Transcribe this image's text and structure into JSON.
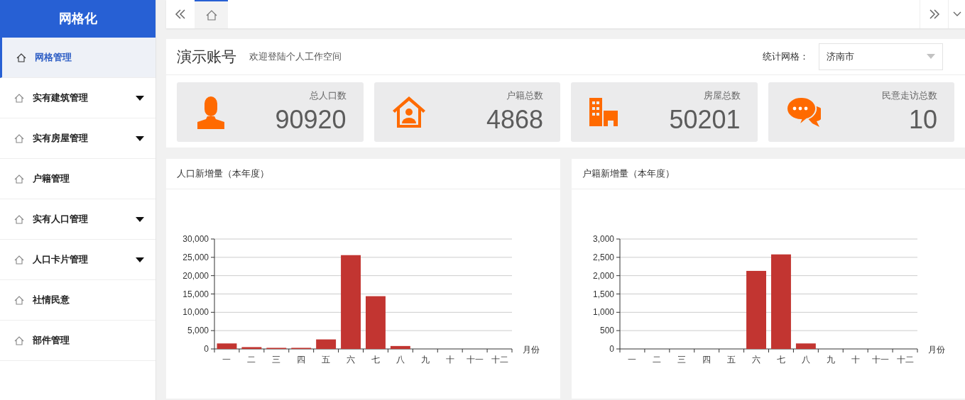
{
  "sidebar": {
    "title": "网格化",
    "items": [
      {
        "label": "网格管理",
        "selected": true,
        "has_submenu": false
      },
      {
        "label": "实有建筑管理",
        "selected": false,
        "has_submenu": true
      },
      {
        "label": "实有房屋管理",
        "selected": false,
        "has_submenu": true
      },
      {
        "label": "户籍管理",
        "selected": false,
        "has_submenu": false
      },
      {
        "label": "实有人口管理",
        "selected": false,
        "has_submenu": true
      },
      {
        "label": "人口卡片管理",
        "selected": false,
        "has_submenu": true
      },
      {
        "label": "社情民意",
        "selected": false,
        "has_submenu": false
      },
      {
        "label": "部件管理",
        "selected": false,
        "has_submenu": false
      }
    ]
  },
  "header": {
    "account": "演示账号",
    "welcome": "欢迎登陆个人工作空间",
    "grid_label": "统计网格：",
    "grid_select": {
      "value": "济南市"
    }
  },
  "stats": [
    {
      "kind": "person",
      "label": "总人口数",
      "value": "90920"
    },
    {
      "kind": "house",
      "label": "户籍总数",
      "value": "4868"
    },
    {
      "kind": "building",
      "label": "房屋总数",
      "value": "50201"
    },
    {
      "kind": "chat",
      "label": "民意走访总数",
      "value": "10"
    }
  ],
  "charts": [
    {
      "title": "人口新增量（本年度）",
      "chart_data": {
        "type": "bar",
        "xlabel": "月份",
        "categories": [
          "一",
          "二",
          "三",
          "四",
          "五",
          "六",
          "七",
          "八",
          "九",
          "十",
          "十一",
          "十二"
        ],
        "grid": true,
        "series": [
          {
            "color": "#c23531",
            "values": [
              1500,
              500,
              300,
              300,
              2600,
              25600,
              14400,
              800,
              0,
              0,
              0,
              0
            ]
          }
        ],
        "ylim": [
          0,
          30000
        ],
        "yticks": [
          {
            "value": 0,
            "label": "0"
          },
          {
            "value": 5000,
            "label": "5,000"
          },
          {
            "value": 10000,
            "label": "10,000"
          },
          {
            "value": 15000,
            "label": "15,000"
          },
          {
            "value": 20000,
            "label": "20,000"
          },
          {
            "value": 25000,
            "label": "25,000"
          },
          {
            "value": 30000,
            "label": "30,000"
          }
        ]
      }
    },
    {
      "title": "户籍新增量（本年度）",
      "chart_data": {
        "type": "bar",
        "xlabel": "月份",
        "categories": [
          "一",
          "二",
          "三",
          "四",
          "五",
          "六",
          "七",
          "八",
          "九",
          "十",
          "十一",
          "十二"
        ],
        "grid": true,
        "series": [
          {
            "color": "#c23531",
            "values": [
              0,
              0,
              0,
              0,
              0,
              2130,
              2580,
              150,
              0,
              0,
              0,
              0
            ]
          }
        ],
        "ylim": [
          0,
          3000
        ],
        "yticks": [
          {
            "value": 0,
            "label": "0"
          },
          {
            "value": 500,
            "label": "500"
          },
          {
            "value": 1000,
            "label": "1,000"
          },
          {
            "value": 1500,
            "label": "1,500"
          },
          {
            "value": 2000,
            "label": "2,000"
          },
          {
            "value": 2500,
            "label": "2,500"
          },
          {
            "value": 3000,
            "label": "3,000"
          }
        ]
      }
    }
  ]
}
